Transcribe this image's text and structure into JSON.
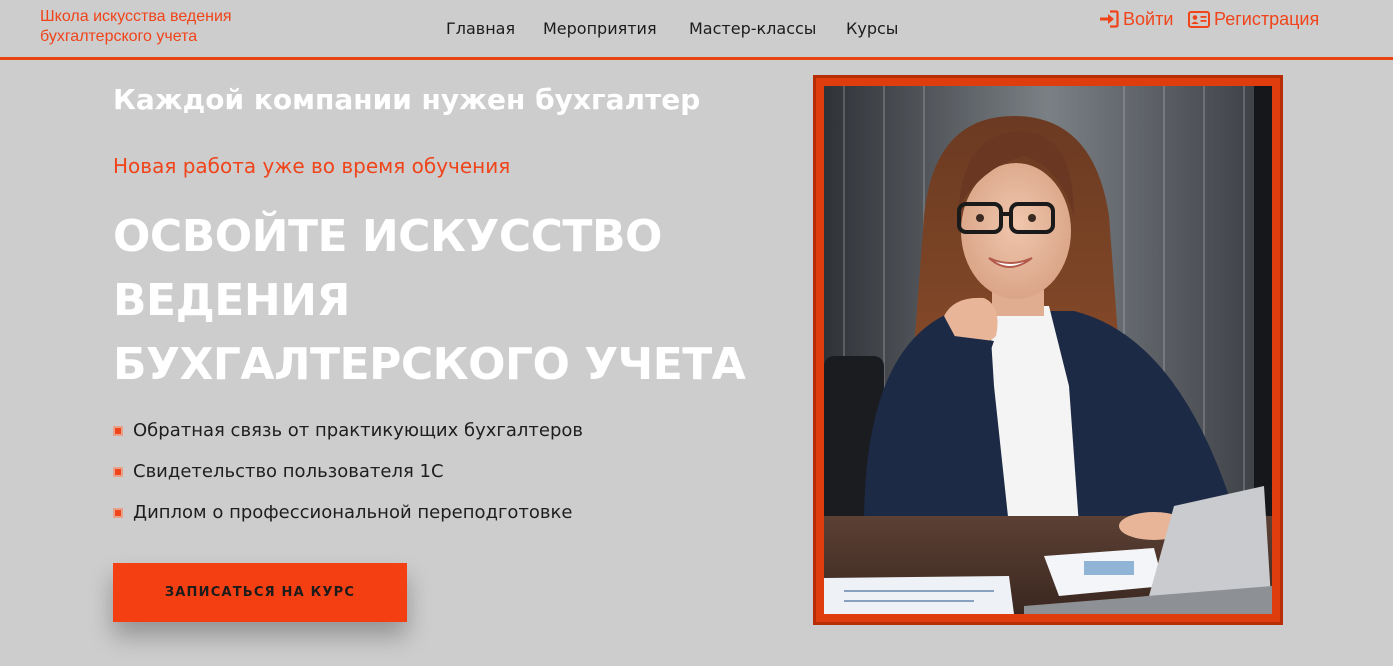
{
  "header": {
    "logo_line1": "Школа искусства ведения",
    "logo_line2": "бухгалтерского учета",
    "nav": [
      "Главная",
      "Мероприятия",
      "Мастер-классы",
      "Курсы"
    ],
    "login_label": "Войти",
    "register_label": "Регистрация",
    "login_icon": "sign-in-icon",
    "register_icon": "id-card-icon"
  },
  "hero": {
    "kicker": "Каждой компании нужен бухгалтер",
    "subtitle": "Новая работа уже во время обучения",
    "headline_lines": [
      "ОСВОЙТЕ ИСКУССТВО",
      "ВЕДЕНИЯ",
      "БУХГАЛТЕРСКОГО УЧЕТА"
    ],
    "features": [
      "Обратная связь от практикующих бухгалтеров",
      "Свидетельство пользователя 1С",
      "Диплом о профессиональной переподготовке"
    ],
    "cta_label": "ЗАПИСАТЬСЯ НА КУРС"
  },
  "colors": {
    "accent": "#f0441a",
    "background": "#cdcdcd",
    "frame": "#e03d0f",
    "text_dark": "#1c1c1c",
    "text_light": "#ffffff"
  }
}
